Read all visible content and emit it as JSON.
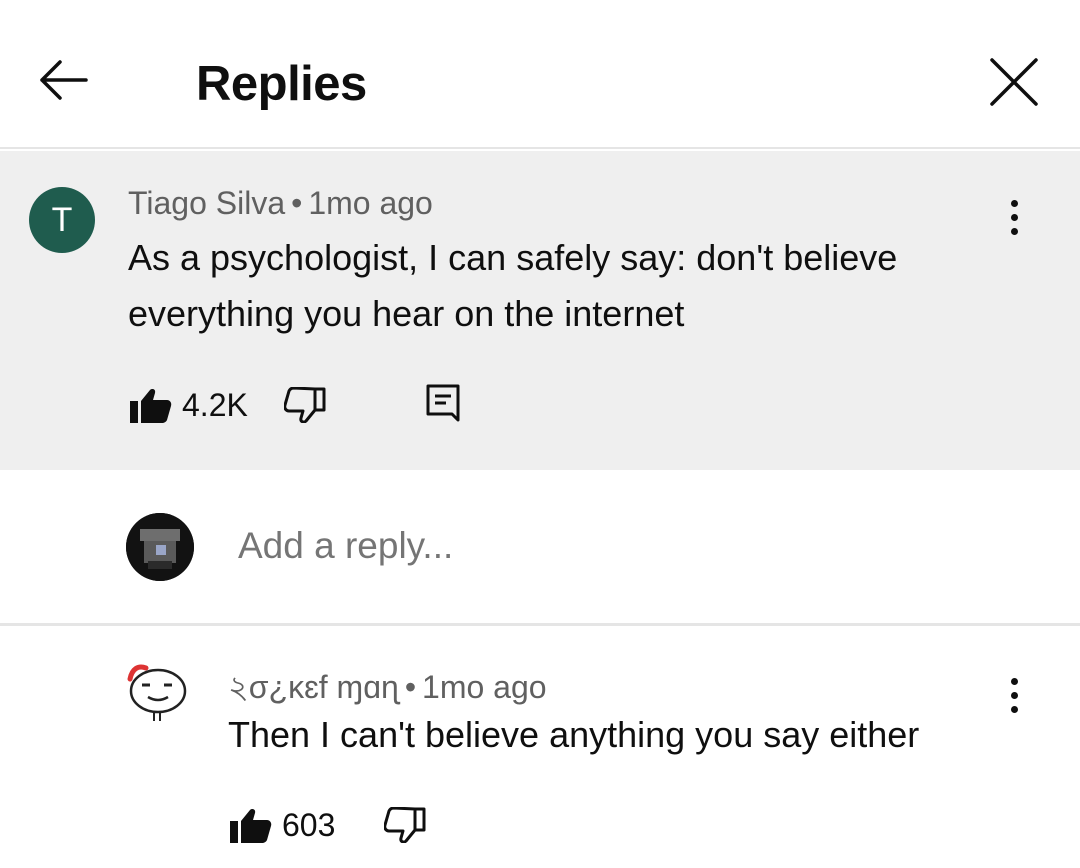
{
  "header": {
    "title": "Replies"
  },
  "parent_comment": {
    "avatar_letter": "T",
    "author": "Tiago Silva",
    "separator": "•",
    "time": "1mo ago",
    "text": "As a psychologist, I can safely say: don't believe everything you hear on the internet",
    "likes": "4.2K"
  },
  "reply_box": {
    "placeholder": "Add a reply..."
  },
  "replies": [
    {
      "author": "২σ¿κɛf ɱɑɳ",
      "separator": "•",
      "time": "1mo ago",
      "text": "Then I can't believe anything you say either",
      "likes": "603"
    }
  ],
  "colors": {
    "parent_background": "#efefef",
    "avatar_t": "#1f5c4e",
    "meta_text": "#606060",
    "placeholder": "#6f6f6f"
  },
  "icons": [
    "back-arrow-icon",
    "close-icon",
    "more-vert-icon",
    "thumb-up-filled-icon",
    "thumb-down-icon",
    "comment-reply-icon"
  ]
}
